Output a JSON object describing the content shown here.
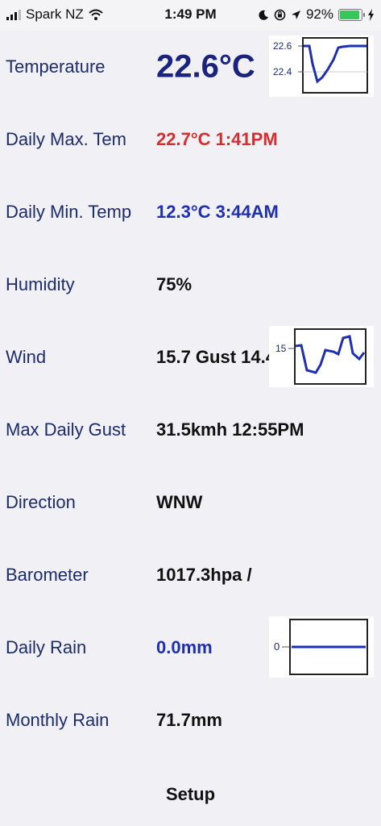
{
  "status_bar": {
    "carrier": "Spark NZ",
    "time": "1:49 PM",
    "battery_percent": "92%",
    "battery_level": 0.92
  },
  "rows": [
    {
      "label": "Temperature",
      "value": "22.6°C"
    },
    {
      "label": "Daily Max. Tem",
      "value": "22.7°C 1:41PM"
    },
    {
      "label": "Daily Min. Temp",
      "value": "12.3°C 3:44AM"
    },
    {
      "label": "Humidity",
      "value": "75%"
    },
    {
      "label": "Wind",
      "value": "15.7 Gust 14.4km"
    },
    {
      "label": "Max Daily Gust",
      "value": "31.5kmh 12:55PM"
    },
    {
      "label": "Direction",
      "value": "WNW"
    },
    {
      "label": "Barometer",
      "value": "1017.3hpa /"
    },
    {
      "label": "Daily Rain",
      "value": "0.0mm"
    },
    {
      "label": "Monthly Rain",
      "value": "71.7mm"
    }
  ],
  "sparklines": {
    "temperature": {
      "tick_top": "22.6",
      "tick_bottom": "22.4"
    },
    "wind": {
      "tick": "15"
    },
    "rain": {
      "tick": "0"
    }
  },
  "footer": {
    "setup_label": "Setup"
  },
  "colors": {
    "label": "#1c2c6b",
    "max_value": "#d32f2f",
    "min_value": "#1e2fb0",
    "line": "#1e2fb0"
  }
}
